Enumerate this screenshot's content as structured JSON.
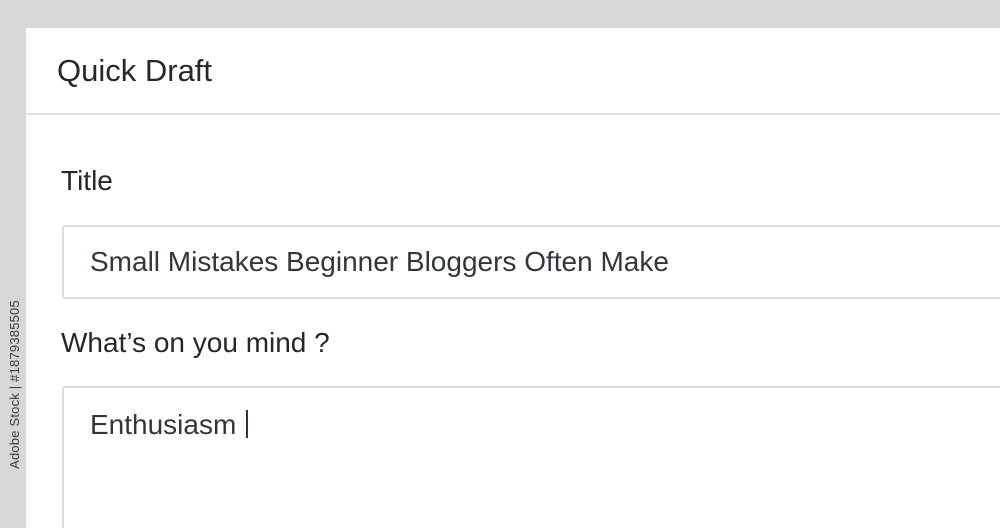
{
  "widget": {
    "title": "Quick Draft"
  },
  "form": {
    "title_label": "Title",
    "title_value": "Small Mistakes Beginner Bloggers Often Make",
    "content_label": "What’s on you mind ?",
    "content_value": "Enthusiasm "
  },
  "watermark": {
    "text": "Adobe Stock | #187938550​5"
  }
}
